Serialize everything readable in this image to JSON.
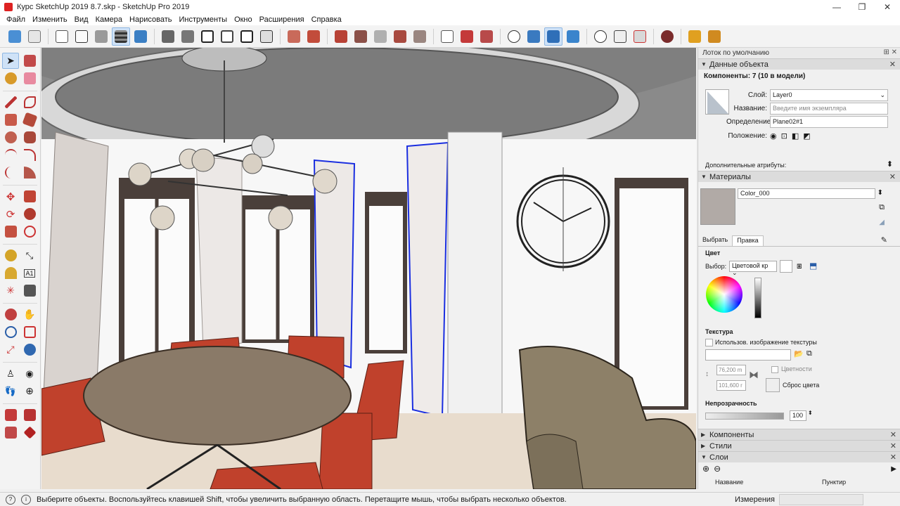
{
  "window": {
    "title": "Курс SketchUp 2019 8.7.skp - SketchUp Pro 2019",
    "minimize": "—",
    "maximize": "❐",
    "close": "✕"
  },
  "menu": [
    "Файл",
    "Изменить",
    "Вид",
    "Камера",
    "Нарисовать",
    "Инструменты",
    "Окно",
    "Расширения",
    "Справка"
  ],
  "tray": {
    "title": "Лоток по умолчанию",
    "entity_info": {
      "header": "Данные объекта",
      "summary": "Компоненты: 7 (10 в модели)",
      "layer_label": "Слой:",
      "layer_value": "Layer0",
      "name_label": "Название:",
      "name_placeholder": "Введите имя экземпляра",
      "definition_label": "Определение:",
      "definition_value": "Plane02#1",
      "position_label": "Положение:",
      "advanced_label": "Дополнительные атрибуты:"
    },
    "materials": {
      "header": "Материалы",
      "material_name": "Color_000",
      "swatch_color": "#b1aaa6",
      "tab_select": "Выбрать",
      "tab_edit": "Правка",
      "color_section": "Цвет",
      "picker_label": "Выбор:",
      "picker_value": "Цветовой кр",
      "texture_section": "Текстура",
      "use_texture_label": "Использов. изображение текстуры",
      "width_value": "76,200 m",
      "height_value": "101,600 r",
      "colorize_label": "Цветности",
      "reset_color_label": "Сброс цвета",
      "opacity_section": "Непрозрачность",
      "opacity_value": "100"
    },
    "components_header": "Компоненты",
    "styles_header": "Стили",
    "layers_header": "Слои",
    "layers_col_name": "Название",
    "layers_col_dashes": "Пунктир"
  },
  "status": {
    "message": "Выберите объекты. Воспользуйтесь клавишей Shift, чтобы увеличить выбранную область. Перетащите мышь, чтобы выбрать несколько объектов.",
    "measurements_label": "Измерения"
  },
  "colors": {
    "accent_selected": "#cfe2f7",
    "selection_blue": "#1a2ee0",
    "chair_red": "#c0412c",
    "table_wood": "#8a7a68"
  }
}
